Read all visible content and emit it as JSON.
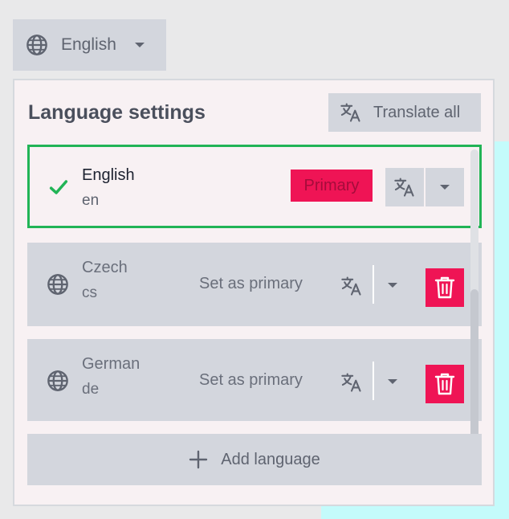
{
  "trigger": {
    "label": "English",
    "icon": "globe-icon",
    "caret": "caret-down-icon"
  },
  "panel": {
    "title": "Language settings",
    "translate_all_label": "Translate all"
  },
  "languages": [
    {
      "name": "English",
      "code": "en",
      "primary": true,
      "badge": "Primary",
      "icon": "check-icon"
    },
    {
      "name": "Czech",
      "code": "cs",
      "primary": false,
      "action": "Set as primary",
      "icon": "globe-icon"
    },
    {
      "name": "German",
      "code": "de",
      "primary": false,
      "action": "Set as primary",
      "icon": "globe-icon"
    }
  ],
  "add_language_label": "Add language",
  "colors": {
    "accent_green": "#21b456",
    "danger_red": "#ef1455",
    "button_gray": "#d3d6dd",
    "panel_bg": "#f8f1f3"
  }
}
